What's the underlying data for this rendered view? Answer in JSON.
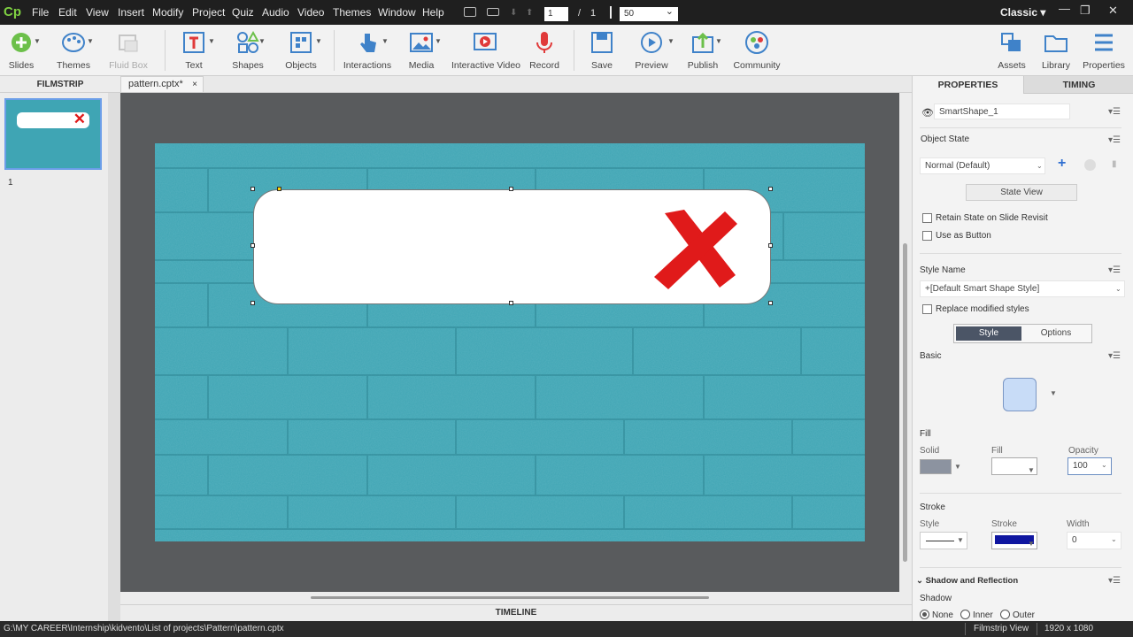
{
  "app": {
    "logo": "Cp"
  },
  "menu": [
    "File",
    "Edit",
    "View",
    "Insert",
    "Modify",
    "Project",
    "Quiz",
    "Audio",
    "Video",
    "Themes",
    "Window",
    "Help"
  ],
  "nav": {
    "current_slide": "1",
    "separator": "/",
    "total_slides": "1",
    "zoom": "50",
    "workspace": "Classic"
  },
  "window_controls": {
    "minimize": "—",
    "maximize": "❐",
    "close": "✕"
  },
  "toolbar": {
    "slides": "Slides",
    "themes": "Themes",
    "fluid_box": "Fluid Box",
    "text": "Text",
    "shapes": "Shapes",
    "objects": "Objects",
    "interactions": "Interactions",
    "media": "Media",
    "interactive_video": "Interactive Video",
    "record": "Record",
    "save": "Save",
    "preview": "Preview",
    "publish": "Publish",
    "community": "Community",
    "assets": "Assets",
    "library": "Library",
    "properties": "Properties"
  },
  "filmstrip": {
    "header": "FILMSTRIP",
    "slide_number": "1"
  },
  "document_tab": {
    "name": "pattern.cptx*",
    "close": "×"
  },
  "timeline": {
    "label": "TIMELINE"
  },
  "properties_panel": {
    "tab_properties": "PROPERTIES",
    "tab_timing": "TIMING",
    "object_name": "SmartShape_1",
    "object_state_title": "Object State",
    "object_state_value": "Normal (Default)",
    "state_view_button": "State View",
    "retain_state": "Retain State on Slide Revisit",
    "use_as_button": "Use as Button",
    "style_name_title": "Style Name",
    "style_name_value": "+[Default Smart Shape Style]",
    "replace_modified": "Replace modified styles",
    "subtab_style": "Style",
    "subtab_options": "Options",
    "basic_title": "Basic",
    "fill_title": "Fill",
    "fill_type_label": "Solid",
    "fill_label": "Fill",
    "opacity_label": "Opacity",
    "opacity_value": "100",
    "stroke_title": "Stroke",
    "stroke_style_label": "Style",
    "stroke_color_label": "Stroke",
    "stroke_width_label": "Width",
    "stroke_width_value": "0",
    "shadow_title": "Shadow and Reflection",
    "shadow_label": "Shadow",
    "shadow_none": "None",
    "shadow_inner": "Inner",
    "shadow_outer": "Outer"
  },
  "colors": {
    "accent": "#2f6fd1",
    "brick": "#3fa5b4",
    "cross": "#e01a1a",
    "stroke_swatch": "#0f16a0",
    "basic_swatch": "#c8dcf7"
  },
  "status": {
    "path": "G:\\MY CAREER\\Internship\\kidvento\\List of projects\\Pattern\\pattern.cptx",
    "view": "Filmstrip View",
    "resolution": "1920 x 1080"
  }
}
